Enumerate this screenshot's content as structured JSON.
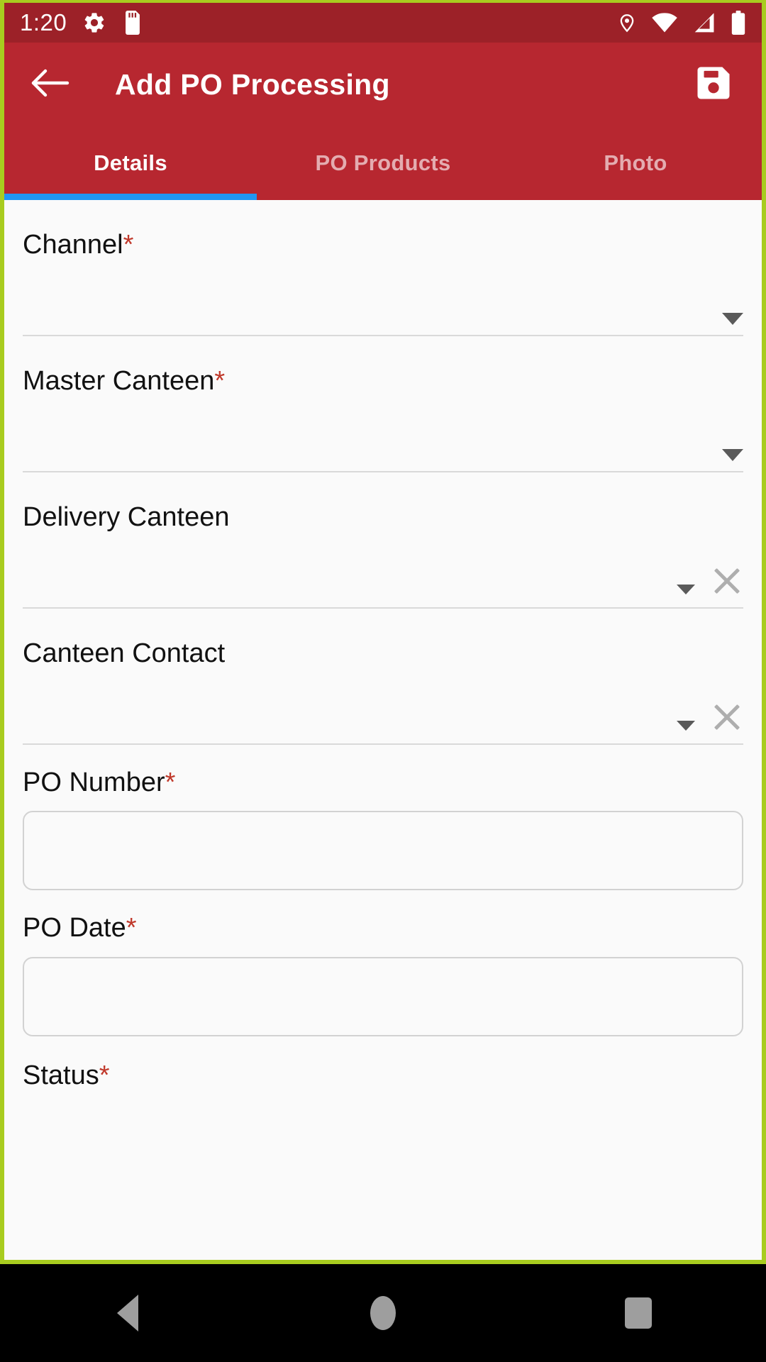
{
  "theme": {
    "primary": "#B72730",
    "status_bar": "#9C2128",
    "accent_indicator": "#2196F3",
    "frame_border": "#A8CC1F",
    "required_marker": "#C0392B",
    "content_bg": "#FAFAFA"
  },
  "status_bar": {
    "clock": "1:20",
    "left_icons": [
      "settings-gear-icon",
      "sd-card-icon"
    ],
    "right_icons": [
      "location-pin-icon",
      "wifi-icon",
      "cellular-signal-icon",
      "battery-icon"
    ]
  },
  "app_bar": {
    "back_icon": "back-arrow-icon",
    "title": "Add PO Processing",
    "save_icon": "save-floppy-icon"
  },
  "tabs": {
    "active_index": 0,
    "items": [
      {
        "label": "Details"
      },
      {
        "label": "PO Products"
      },
      {
        "label": "Photo"
      }
    ]
  },
  "form": {
    "fields": [
      {
        "label": "Channel",
        "required": true,
        "type": "dropdown",
        "value": "",
        "placeholder": "",
        "has_clear": false
      },
      {
        "label": "Master Canteen",
        "required": true,
        "type": "dropdown",
        "value": "",
        "placeholder": "",
        "has_clear": false
      },
      {
        "label": "Delivery Canteen",
        "required": false,
        "type": "dropdown",
        "value": "",
        "placeholder": "",
        "has_clear": true
      },
      {
        "label": "Canteen Contact",
        "required": false,
        "type": "dropdown",
        "value": "",
        "placeholder": "",
        "has_clear": true
      },
      {
        "label": "PO Number",
        "required": true,
        "type": "text",
        "value": "",
        "placeholder": "",
        "has_clear": false
      },
      {
        "label": "PO Date",
        "required": true,
        "type": "text",
        "value": "",
        "placeholder": "",
        "has_clear": false
      },
      {
        "label": "Status",
        "required": true,
        "type": "dropdown",
        "value": "",
        "placeholder": "",
        "has_clear": false,
        "cut_off": true
      }
    ]
  },
  "nav_bar": {
    "buttons": [
      {
        "name": "back",
        "icon": "triangle-back-icon"
      },
      {
        "name": "home",
        "icon": "circle-home-icon"
      },
      {
        "name": "recents",
        "icon": "square-recents-icon"
      }
    ]
  }
}
